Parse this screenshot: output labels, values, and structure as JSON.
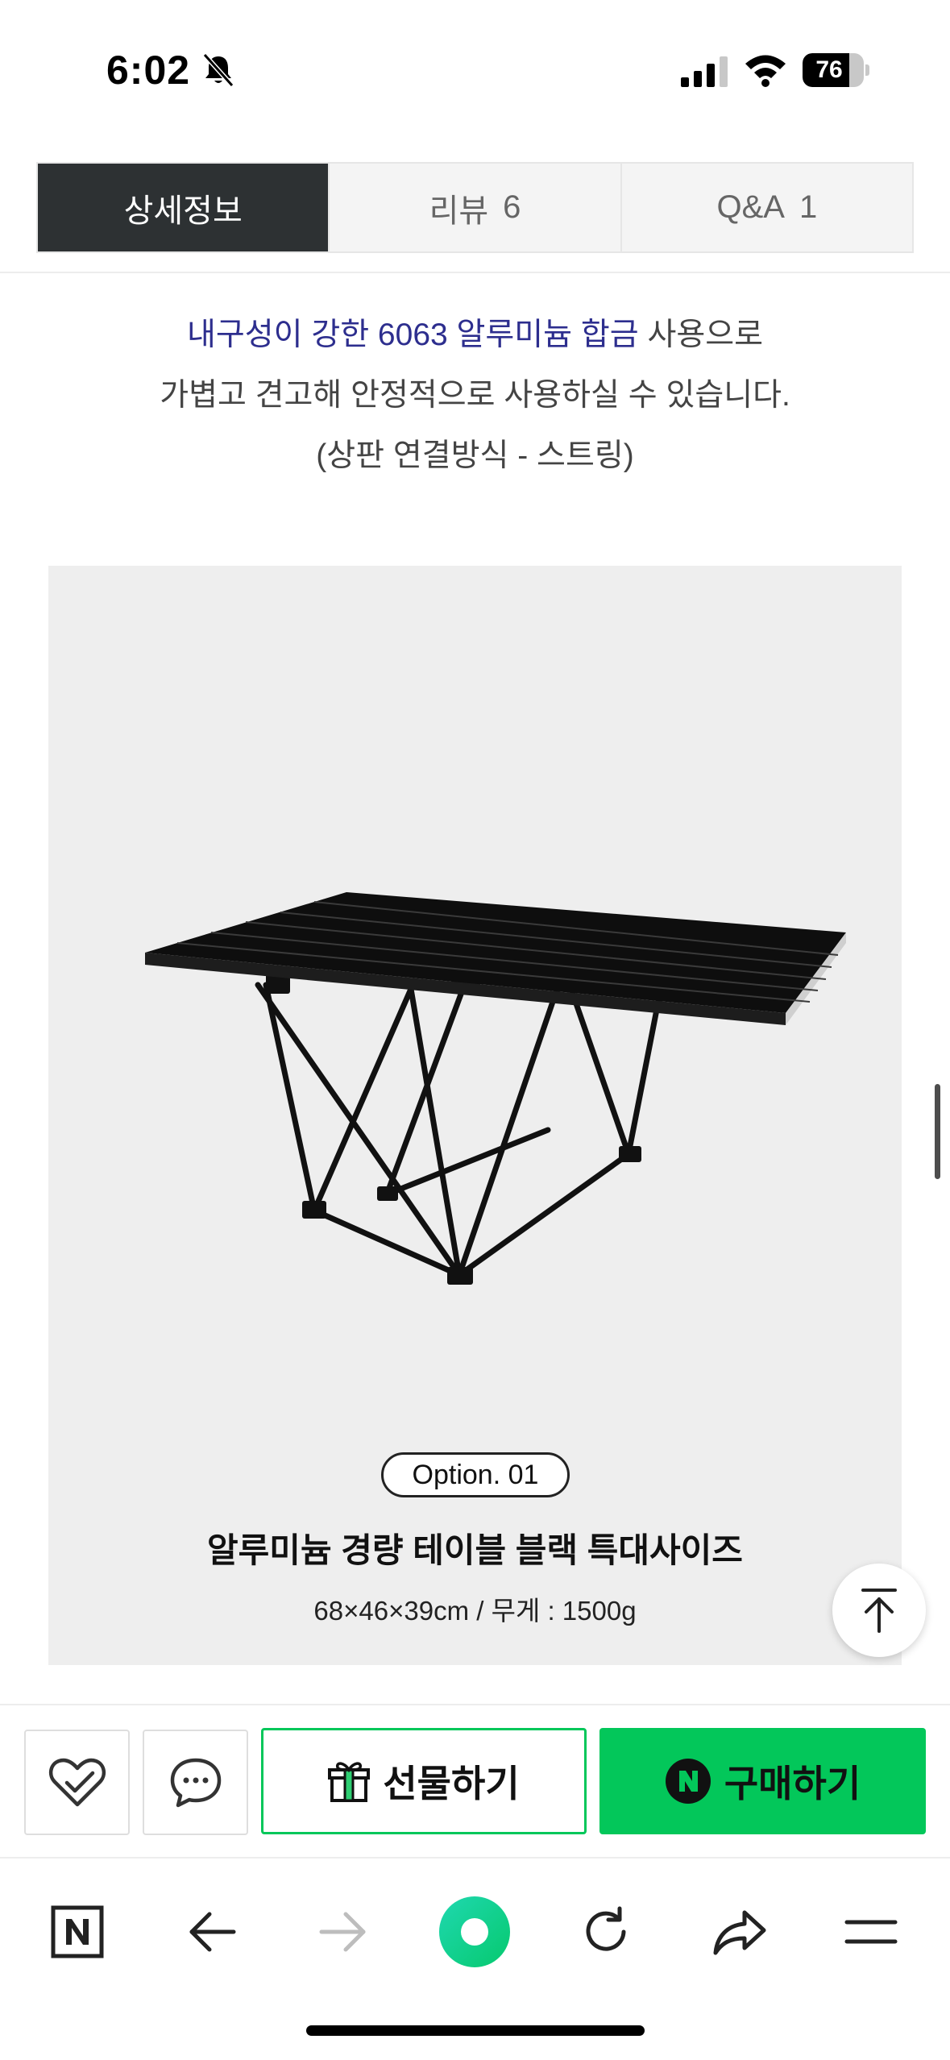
{
  "status_bar": {
    "time": "6:02",
    "battery_level": "76",
    "battery_fraction": 0.76,
    "icons": [
      "bell-slash-icon",
      "cellular-signal-icon",
      "wifi-icon",
      "battery-icon"
    ]
  },
  "tabs": [
    {
      "label": "상세정보",
      "count": "",
      "active": true
    },
    {
      "label": "리뷰",
      "count": "6",
      "active": false
    },
    {
      "label": "Q&A",
      "count": "1",
      "active": false
    }
  ],
  "description": {
    "line1_highlight": "내구성이 강한 6063 알루미늄 합금",
    "line1_rest": " 사용으로",
    "line2": "가볍고 견고해 안정적으로 사용하실 수 있습니다.",
    "line3": "(상판 연결방식 - 스트링)"
  },
  "product": {
    "option_badge": "Option. 01",
    "name": "알루미늄 경량 테이블 블랙 특대사이즈",
    "spec": "68×46×39cm  /  무게 : 1500g"
  },
  "purchase_bar": {
    "wishlist_icon": "heart-check-icon",
    "talk_icon": "chat-bubble-icon",
    "gift_label": "선물하기",
    "gift_icon": "gift-box-icon",
    "buy_label": "구매하기",
    "buy_icon": "naver-n-icon",
    "colors": {
      "accent": "#03c75a",
      "tab_active": "#2d3133",
      "highlight_text": "#2d2e8e"
    }
  },
  "browser_bar": {
    "icons": [
      "naver-n-home-icon",
      "back-arrow-icon",
      "forward-arrow-icon",
      "green-dot-icon",
      "reload-icon",
      "share-icon",
      "menu-icon"
    ]
  }
}
